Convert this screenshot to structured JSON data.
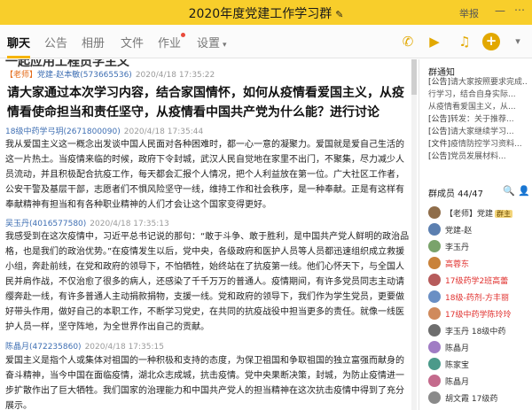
{
  "window": {
    "title": "2020年度党建工作学习群",
    "edit_icon": "pencil-icon",
    "report": "举报",
    "minimize": "—",
    "more": "⋯"
  },
  "tabs": [
    {
      "label": "聊天",
      "active": true
    },
    {
      "label": "公告"
    },
    {
      "label": "相册"
    },
    {
      "label": "文件"
    },
    {
      "label": "作业"
    },
    {
      "label": "设置"
    }
  ],
  "nav_icons": [
    "phone-icon",
    "video-icon",
    "headset-icon",
    "add-icon"
  ],
  "chat": {
    "clipped_top": "一起应用工程员学主义",
    "messages": [
      {
        "tag": "【老师】",
        "sender": "党建-赵本敏(573665536)",
        "time": "2020/4/18 17:35:22",
        "text": "请大家通过本次学习内容，结合家国情怀，如何从疫情看爱国主义，从疫情看使命担当和责任坚守，从疫情看中国共产党为什么能？进行讨论"
      },
      {
        "sender": "18级中药学弓玥(2671800090)",
        "time": "2020/4/18 17:35:44",
        "text": "我从爱国主义这一概念出发谈中国人民面对各种困难时，都一心一意的凝聚力。爱国就是爱自己生活的这一片热土。当疫情来临的时候，政府下令封城，武汉人民自觉地在家里不出门，不聚集，尽力减少人员流动，并且积极配合抗疫工作，每天都会汇报个人情况，把个人利益放在第一位。广大社区工作者，公安干警及基层干部，志愿者们不惧风险坚守一线，维持工作和社会秩序，是一种奉献。正是有这样有奉献精神有担当和有各种职业精神的人们才会让这个国家变得更好。"
      },
      {
        "sender": "吴玉丹(4016577580)",
        "time": "2020/4/18 17:35:13",
        "text": "我感受到在这次疫情中，习近平总书记说的那句：“敢于斗争、敢于胜利，是中国共产党人鲜明的政治品格，也是我们的政治优势。”在疫情发生以后，党中央，各级政府和医护人员等人员都迅速组织成立救援小组，奔赴前线，在党和政府的领导下，不怕牺牲，始终站在了抗疫第一线。他们心怀天下，与全国人民并肩作战，不仅治愈了很多的病人，还感染了千千万万的普通人。疫情期间，有许多党员同志主动请缨奔赴一线，有许多普通人主动捐款捐物，支援一线。党和政府的领导下，我们作为学生党员，更要做好带头作用，做好自己的本职工作，不断学习党史，在共同的抗疫战役中担当更多的责任。就像一线医护人员一样，坚守阵地，为全世界作出自己的贡献。"
      },
      {
        "sender": "陈晶月(472235860)",
        "time": "2020/4/18 17:35:15",
        "text": "爱国主义是指个人或集体对祖国的一种积极和支持的态度，为保卫祖国和争取祖国的独立富强而献身的奋斗精神，当今中国在面临疫情，湖北众志成城，抗击疫情。党中央果断决策，封城，为防止疫情进一步扩散作出了巨大牺牲。我们国家的治理能力和中国共产党人的担当精神在这次抗击疫情中得到了充分展示。"
      }
    ]
  },
  "sidebar": {
    "notice_title": "群通知",
    "notices": [
      {
        "tag": "[公告]",
        "text": "请大家按照要求完成..."
      },
      {
        "tag": "",
        "text": "行学习，结合自身实际..."
      },
      {
        "tag": "",
        "text": "从疫情看爱国主义，从..."
      },
      {
        "tag": "[公告]",
        "text": "转发：关于推荐..."
      },
      {
        "tag": "[公告]",
        "text": "请大家继续学习..."
      },
      {
        "tag": "[文件]",
        "text": "疫情防控学习资料..."
      },
      {
        "tag": "[公告]",
        "text": "党员发展材料..."
      }
    ],
    "members_label": "群成员 44/47",
    "member_icons": "🔍 👤",
    "members": [
      {
        "name": "【老师】党建",
        "role": "群主",
        "color": "#8f6d4a",
        "red": false
      },
      {
        "name": "党建-赵",
        "color": "#5b7fb0",
        "red": false
      },
      {
        "name": "李玉丹",
        "color": "#7aa36b",
        "red": false
      },
      {
        "name": "高蓉东",
        "color": "#c9823a",
        "red": true
      },
      {
        "name": "17级药学2班高蕾",
        "color": "#b65b5b",
        "red": true
      },
      {
        "name": "18级-药剂-方丰丽",
        "color": "#6a8fc4",
        "red": true
      },
      {
        "name": "17级中药学陈玲玲",
        "color": "#d08a5c",
        "red": true
      },
      {
        "name": "李玉丹 18级中药",
        "color": "#6d6d6d",
        "red": false
      },
      {
        "name": "陈晶月",
        "color": "#a07cc4",
        "red": false
      },
      {
        "name": "陈家宝",
        "color": "#4b9a8a",
        "red": false
      },
      {
        "name": "陈晶月",
        "color": "#c46a8c",
        "red": false
      },
      {
        "name": "胡文霞 17级药",
        "color": "#8a8a8a",
        "red": false
      }
    ]
  }
}
